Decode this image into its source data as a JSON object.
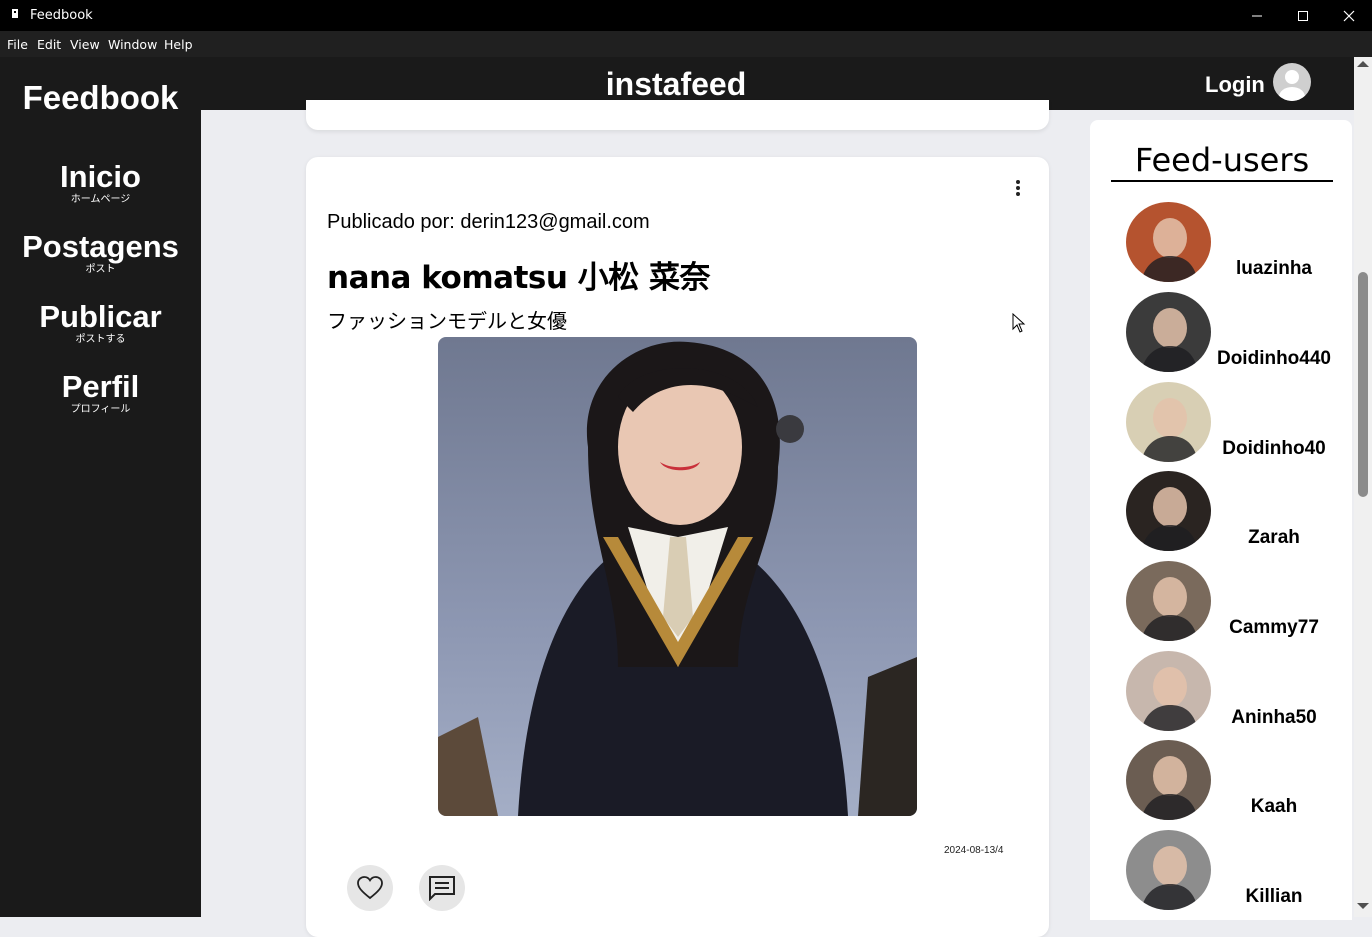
{
  "window": {
    "title": "Feedbook"
  },
  "menu": [
    "File",
    "Edit",
    "View",
    "Window",
    "Help"
  ],
  "sidebar": {
    "brand": "Feedbook",
    "items": [
      {
        "label": "Inicio",
        "sub": "ホームページ"
      },
      {
        "label": "Postagens",
        "sub": "ポスト"
      },
      {
        "label": "Publicar",
        "sub": "ポストする"
      },
      {
        "label": "Perfil",
        "sub": "プロフィール"
      }
    ]
  },
  "header": {
    "title": "instafeed",
    "login_label": "Login"
  },
  "post": {
    "byline": "Publicado por: derin123@gmail.com",
    "title": "nana komatsu 小松 菜奈",
    "description": "ファッションモデルと女優",
    "date": "2024-08-13/4",
    "like_icon": "heart-icon",
    "comment_icon": "comment-icon"
  },
  "users_panel": {
    "title": "Feed-users",
    "users": [
      {
        "name": "luazinha",
        "color": "#b5532f"
      },
      {
        "name": "Doidinho440",
        "color": "#3b3b3b"
      },
      {
        "name": "Doidinho40",
        "color": "#d8cfb4"
      },
      {
        "name": "Zarah",
        "color": "#2a2421"
      },
      {
        "name": "Cammy77",
        "color": "#7a6a5c"
      },
      {
        "name": "Aninha50",
        "color": "#c7b7ad"
      },
      {
        "name": "Kaah",
        "color": "#6b5d52"
      },
      {
        "name": "Killian",
        "color": "#8d8d8d"
      }
    ]
  }
}
